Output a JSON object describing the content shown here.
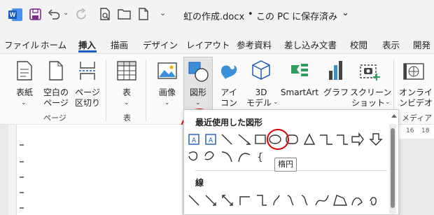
{
  "title": {
    "filename": "虹の作成.docx",
    "separator": "•",
    "location": "この PC に保存済み",
    "chevron": "⌄"
  },
  "tabs": [
    "ファイル",
    "ホーム",
    "挿入",
    "描画",
    "デザイン",
    "レイアウト",
    "参考資料",
    "差し込み文書",
    "校閲",
    "表示",
    "開発"
  ],
  "ribbon": {
    "cover": {
      "l1": "表紙",
      "l2": ""
    },
    "blank": {
      "l1": "空白の",
      "l2": "ページ"
    },
    "pbreak": {
      "l1": "ページ",
      "l2": "区切り"
    },
    "table": {
      "l1": "表"
    },
    "image": {
      "l1": "画像"
    },
    "shapes": {
      "l1": "図形"
    },
    "icons": {
      "l1": "アイ",
      "l2": "コン"
    },
    "model3d": {
      "l1": "3D",
      "l2": "モデル"
    },
    "smartart": {
      "l1": "SmartArt"
    },
    "chart": {
      "l1": "グラフ"
    },
    "screenshot": {
      "l1": "スクリーン",
      "l2": "ショット"
    },
    "video": {
      "l1": "オンライ",
      "l2": "ンビデオ"
    }
  },
  "groups": {
    "pages": "ページ",
    "table": "表",
    "media": "メディア"
  },
  "ruler": {
    "a": "16",
    "b": "18"
  },
  "gallery": {
    "recent": "最近使用した図形",
    "lines": "線",
    "tooltip": "楕円"
  },
  "accent": "#185abd",
  "highlight": "#e00000"
}
